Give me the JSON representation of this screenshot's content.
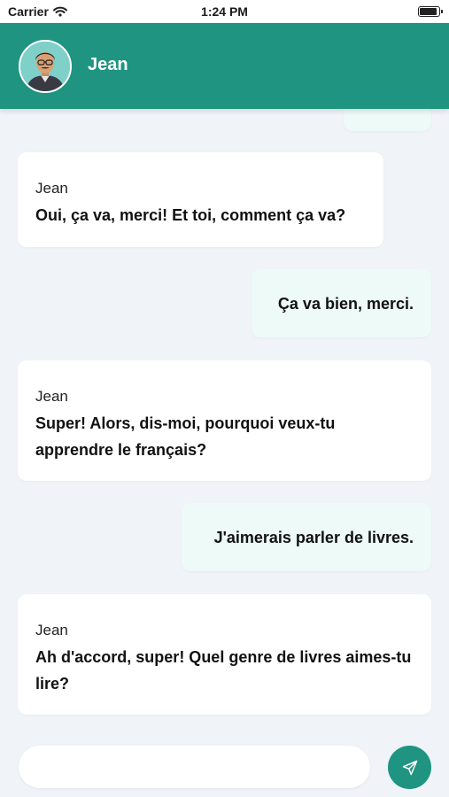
{
  "status_bar": {
    "carrier": "Carrier",
    "time": "1:24 PM",
    "battery_level": 0.9
  },
  "header": {
    "contact_name": "Jean"
  },
  "messages": [
    {
      "from": "contact",
      "sender": "Jean",
      "text": "Oui, ça va, merci! Et toi, comment ça va?"
    },
    {
      "from": "me",
      "text": "Ça va bien, merci."
    },
    {
      "from": "contact",
      "sender": "Jean",
      "text": "Super! Alors, dis-moi, pourquoi veux-tu apprendre le français?"
    },
    {
      "from": "me",
      "text": "J'aimerais parler de livres."
    },
    {
      "from": "contact",
      "sender": "Jean",
      "text": "Ah d'accord, super! Quel genre de livres aimes-tu lire?"
    }
  ],
  "composer": {
    "value": "",
    "placeholder": ""
  },
  "icons": {
    "avatar": "person-avatar",
    "send": "send-icon",
    "wifi": "wifi-icon",
    "battery": "battery-icon"
  },
  "colors": {
    "accent": "#1e9481",
    "incoming_bubble": "#ffffff",
    "outgoing_bubble": "#edfaf7",
    "background": "#f0f3f8"
  }
}
